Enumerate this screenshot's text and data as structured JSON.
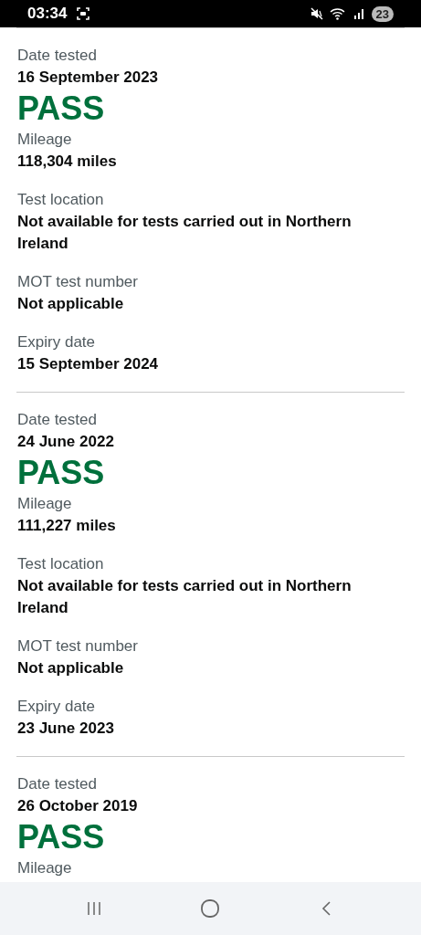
{
  "status_bar": {
    "time": "03:34",
    "battery": "23"
  },
  "records": [
    {
      "items": [
        {
          "kind": "field",
          "label": "Date tested",
          "value": "16 September 2023"
        },
        {
          "kind": "result",
          "value": "PASS"
        },
        {
          "kind": "field",
          "label": "Mileage",
          "value": "118,304 miles"
        },
        {
          "kind": "field",
          "label": "Test location",
          "value": "Not available for tests carried out in Northern Ireland"
        },
        {
          "kind": "field",
          "label": "MOT test number",
          "value": "Not applicable"
        },
        {
          "kind": "field",
          "label": "Expiry date",
          "value": "15 September 2024"
        }
      ]
    },
    {
      "items": [
        {
          "kind": "field",
          "label": "Date tested",
          "value": "24 June 2022"
        },
        {
          "kind": "result",
          "value": "PASS"
        },
        {
          "kind": "field",
          "label": "Mileage",
          "value": "111,227 miles"
        },
        {
          "kind": "field",
          "label": "Test location",
          "value": "Not available for tests carried out in Northern Ireland"
        },
        {
          "kind": "field",
          "label": "MOT test number",
          "value": "Not applicable"
        },
        {
          "kind": "field",
          "label": "Expiry date",
          "value": "23 June 2023"
        }
      ]
    },
    {
      "items": [
        {
          "kind": "field",
          "label": "Date tested",
          "value": "26 October 2019"
        },
        {
          "kind": "result",
          "value": "PASS"
        },
        {
          "kind": "label",
          "label": "Mileage"
        }
      ]
    }
  ]
}
